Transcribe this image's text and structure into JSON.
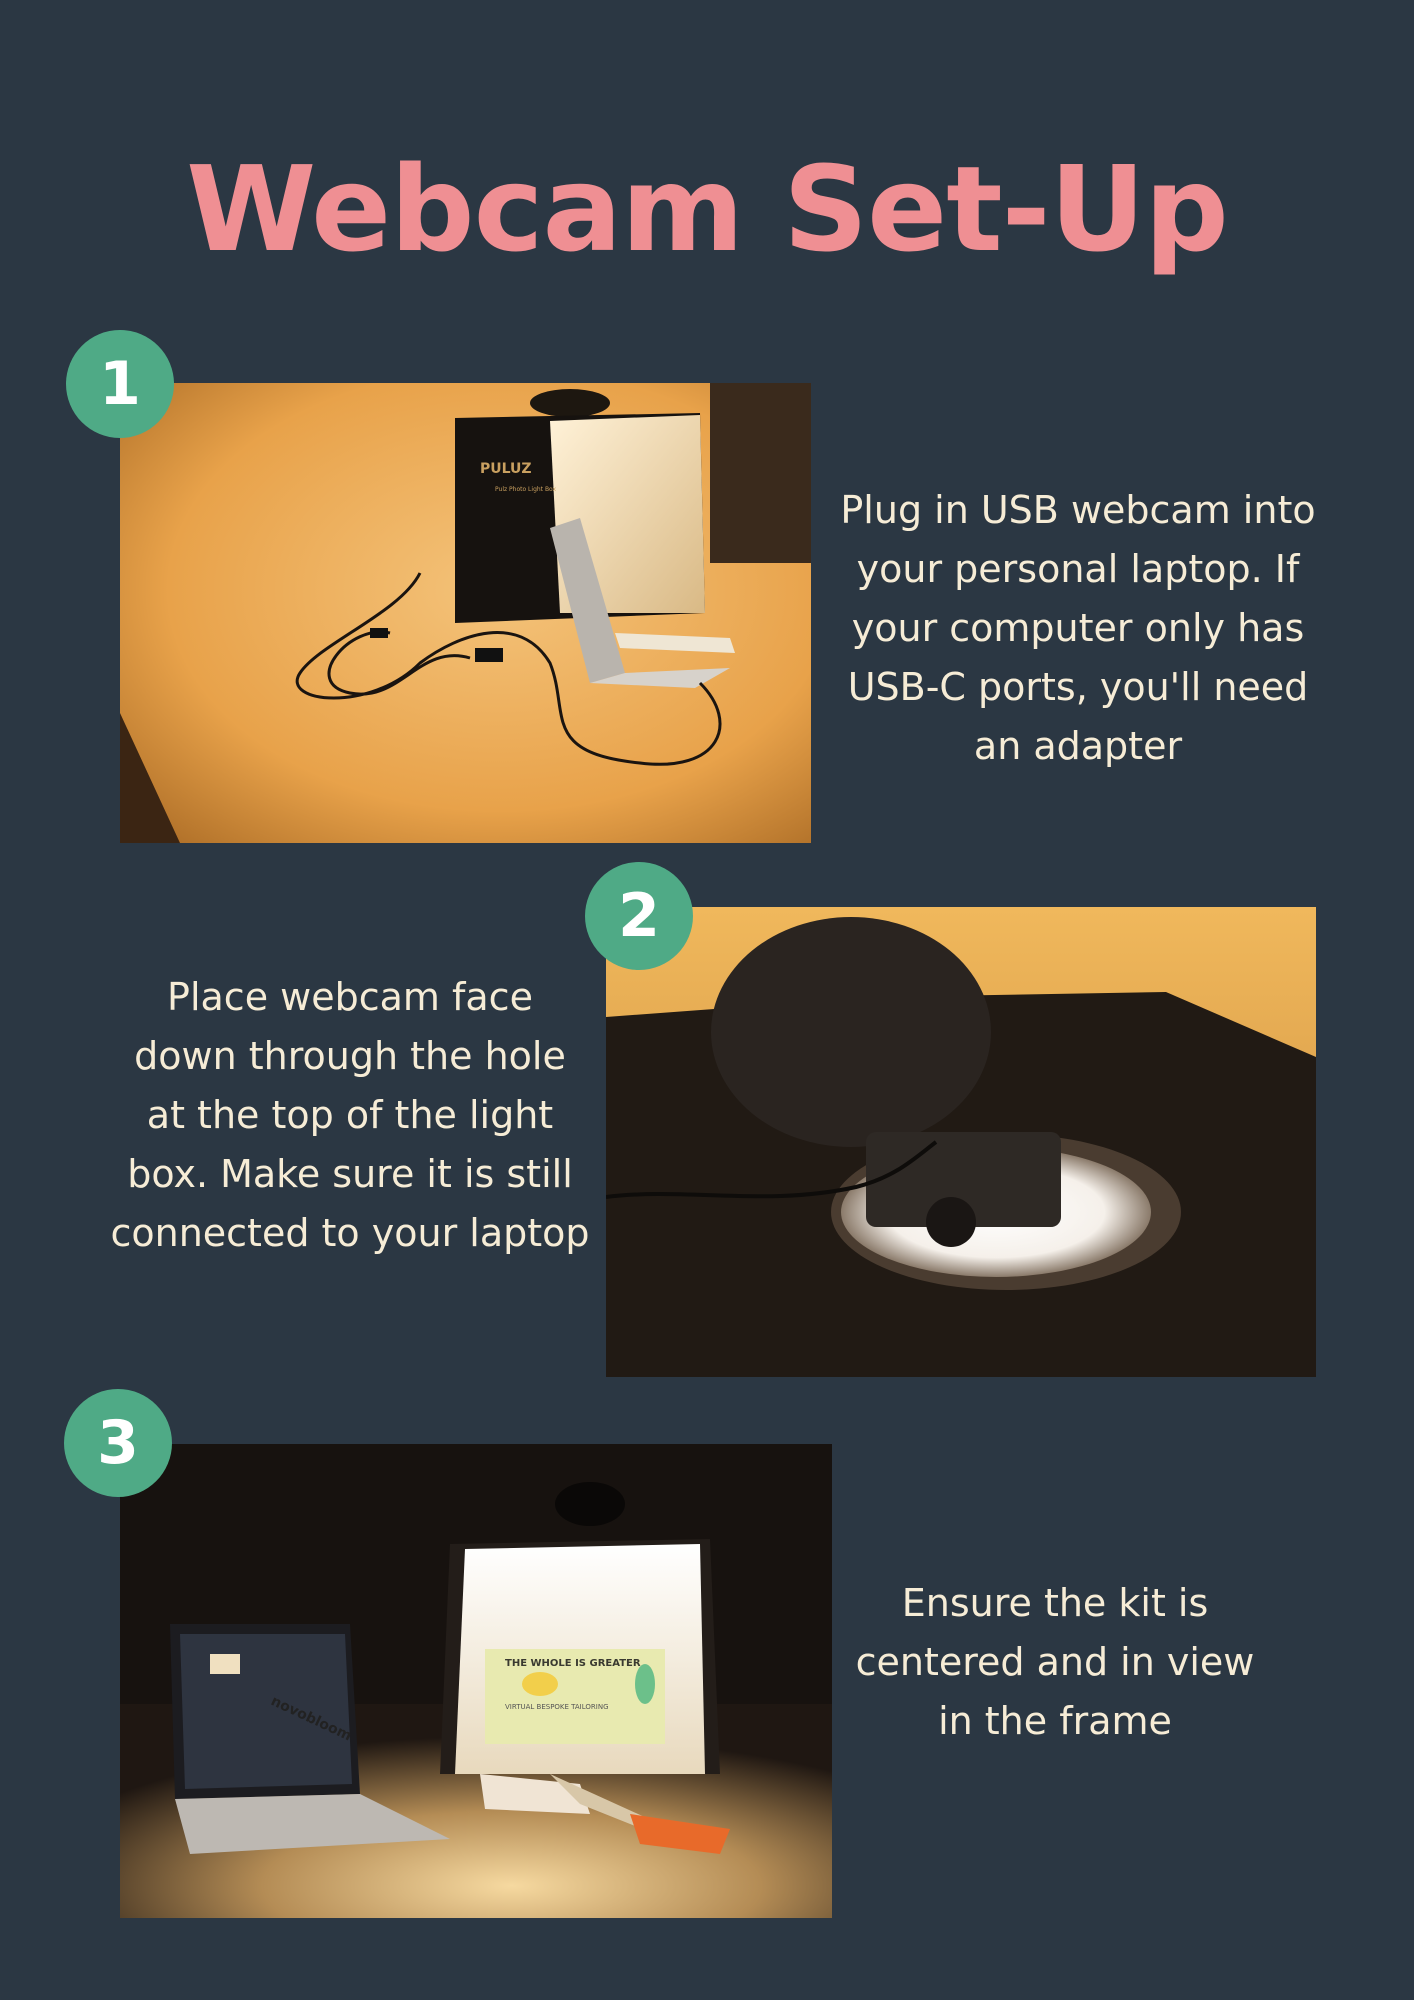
{
  "title": "Webcam Set-Up",
  "colors": {
    "background": "#2b3743",
    "title": "#ef8f93",
    "badge": "#4faa86",
    "text": "#f6ecd6"
  },
  "steps": [
    {
      "number": "1",
      "text": "Plug in USB webcam into your personal laptop. If your computer only has USB-C ports, you'll need an adapter",
      "photo": {
        "box_brand": "PULUZ",
        "box_subtitle": "Pulz Photo Light Box"
      }
    },
    {
      "number": "2",
      "text": "Place webcam face down through the hole at the top of the light box. Make sure it is still connected to your laptop"
    },
    {
      "number": "3",
      "text": "Ensure the kit is centered and in view in the frame",
      "photo": {
        "box_label": "THE WHOLE IS GREATER",
        "box_sublabel": "VIRTUAL BESPOKE TAILORING",
        "screen_text": "novobloom"
      }
    }
  ]
}
